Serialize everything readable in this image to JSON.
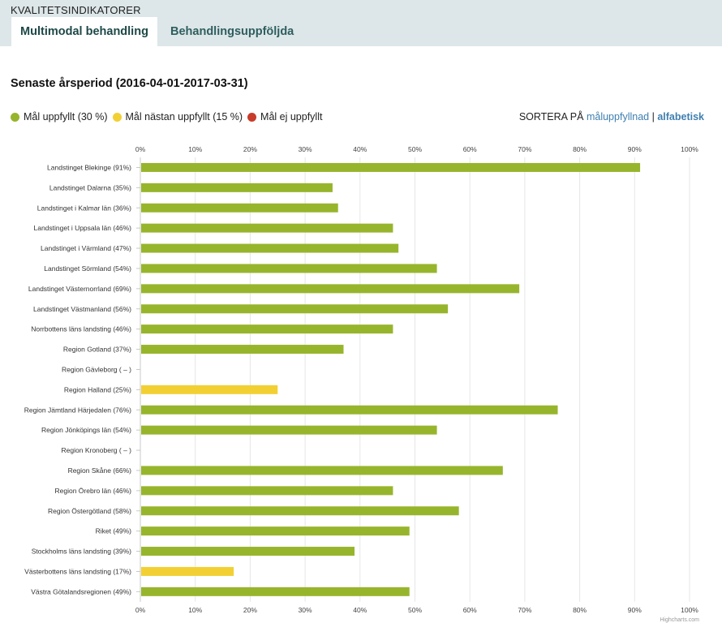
{
  "header": {
    "section_label": "KVALITETSINDIKATORER",
    "tabs": [
      {
        "label": "Multimodal behandling",
        "active": true
      },
      {
        "label": "Behandlingsuppföljda",
        "active": false
      }
    ]
  },
  "period_title": "Senaste årsperiod (2016-04-01-2017-03-31)",
  "legend": [
    {
      "label": "Mål uppfyllt (30 %)",
      "color": "#97b52c"
    },
    {
      "label": "Mål nästan uppfyllt (15 %)",
      "color": "#f2d033"
    },
    {
      "label": "Mål ej uppfyllt",
      "color": "#c93c2a"
    }
  ],
  "sort": {
    "prefix": "SORTERA PÅ",
    "options": [
      {
        "label": "måluppfyllnad",
        "active": false
      },
      {
        "label": "alfabetisk",
        "active": true
      }
    ],
    "separator": "|"
  },
  "credit": "Highcharts.com",
  "chart_data": {
    "type": "bar",
    "orientation": "horizontal",
    "xlim": [
      0,
      100
    ],
    "tick_labels": [
      "0%",
      "10%",
      "20%",
      "30%",
      "40%",
      "50%",
      "60%",
      "70%",
      "80%",
      "90%",
      "100%"
    ],
    "grid": true,
    "categories": [
      "Landstinget Blekinge (91%)",
      "Landstinget Dalarna (35%)",
      "Landstinget i Kalmar län (36%)",
      "Landstinget i Uppsala län (46%)",
      "Landstinget i Värmland (47%)",
      "Landstinget Sörmland (54%)",
      "Landstinget Västernorrland (69%)",
      "Landstinget Västmanland (56%)",
      "Norrbottens läns landsting (46%)",
      "Region Gotland (37%)",
      "Region Gävleborg ( – )",
      "Region Halland (25%)",
      "Region Jämtland Härjedalen (76%)",
      "Region Jönköpings län (54%)",
      "Region Kronoberg ( – )",
      "Region Skåne (66%)",
      "Region Örebro län (46%)",
      "Region Östergötland (58%)",
      "Riket (49%)",
      "Stockholms läns landsting (39%)",
      "Västerbottens läns landsting (17%)",
      "Västra Götalandsregionen (49%)"
    ],
    "values": [
      91,
      35,
      36,
      46,
      47,
      54,
      69,
      56,
      46,
      37,
      null,
      25,
      76,
      54,
      null,
      66,
      46,
      58,
      49,
      39,
      17,
      49
    ],
    "status": [
      "met",
      "met",
      "met",
      "met",
      "met",
      "met",
      "met",
      "met",
      "met",
      "met",
      null,
      "nearly",
      "met",
      "met",
      null,
      "met",
      "met",
      "met",
      "met",
      "met",
      "nearly",
      "met"
    ],
    "status_colors": {
      "met": "#97b52c",
      "nearly": "#f2d033",
      "not_met": "#c93c2a"
    }
  }
}
